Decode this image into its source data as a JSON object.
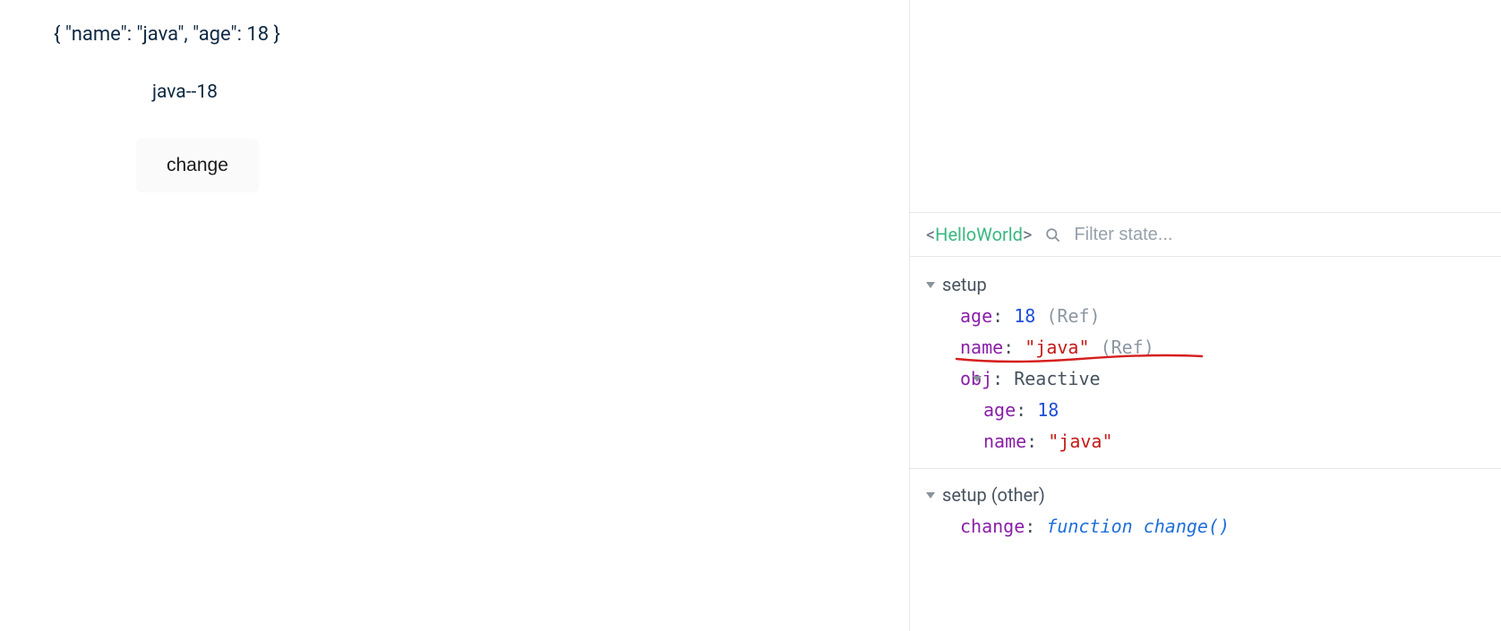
{
  "app": {
    "json_display": "{ \"name\": \"java\", \"age\": 18 }",
    "data_text": "java--18",
    "button_label": "change"
  },
  "devtools": {
    "component_name": "HelloWorld",
    "filter_placeholder": "Filter state...",
    "sections": {
      "setup": {
        "label": "setup",
        "props": [
          {
            "key": "age",
            "value": "18",
            "type": "num",
            "suffix": "(Ref)"
          },
          {
            "key": "name",
            "value": "\"java\"",
            "type": "str",
            "suffix": "(Ref)"
          }
        ],
        "obj": {
          "key": "obj",
          "type_label": "Reactive",
          "props": [
            {
              "key": "age",
              "value": "18",
              "type": "num"
            },
            {
              "key": "name",
              "value": "\"java\"",
              "type": "str"
            }
          ]
        }
      },
      "setup_other": {
        "label": "setup (other)",
        "props": [
          {
            "key": "change",
            "func_kw": "function",
            "func_name": "change()"
          }
        ]
      }
    }
  }
}
